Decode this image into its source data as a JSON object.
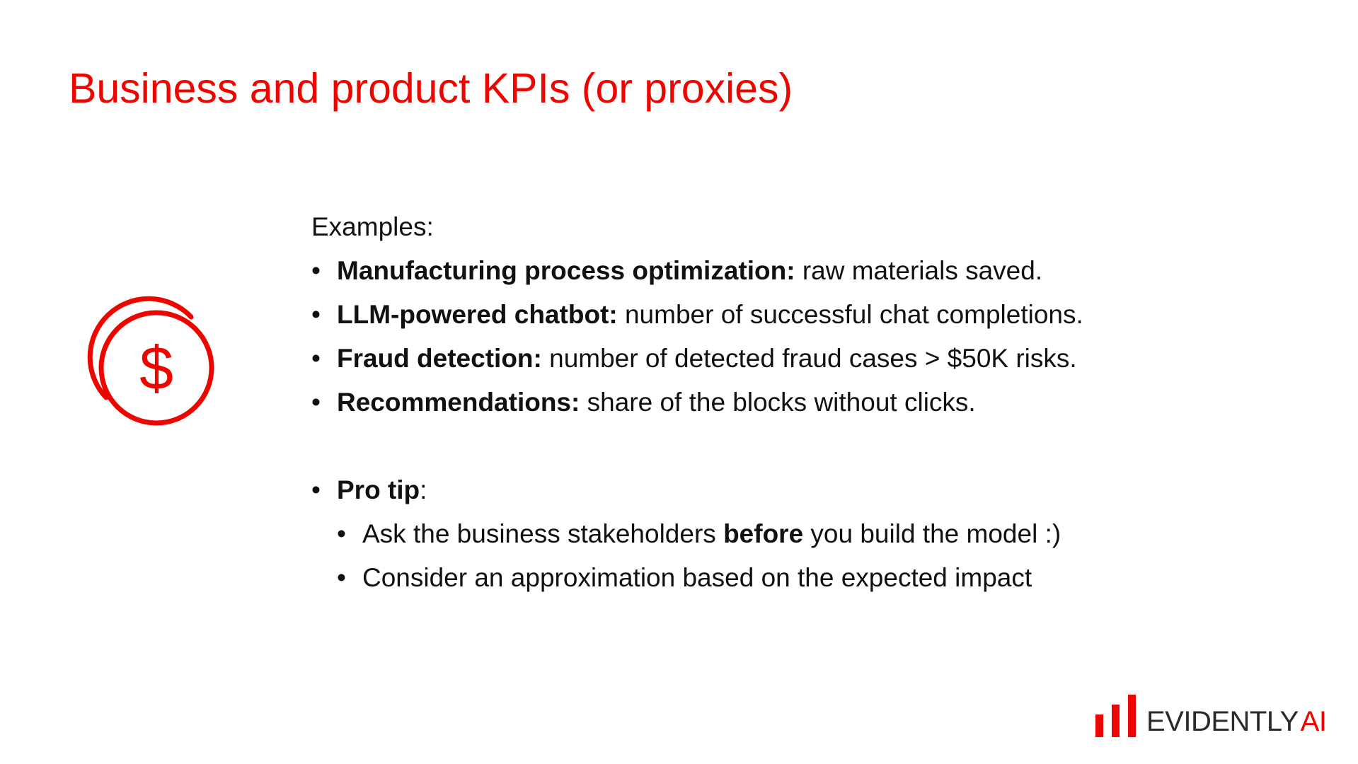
{
  "slide": {
    "title": "Business and product KPIs (or proxies)",
    "accent_color": "#ed0500",
    "intro": "Examples:",
    "examples": [
      {
        "label": "Manufacturing process optimization:",
        "text": " raw materials saved."
      },
      {
        "label": "LLM-powered chatbot:",
        "text": " number of successful chat completions."
      },
      {
        "label": "Fraud detection:",
        "text": " number of detected fraud cases > $50K risks."
      },
      {
        "label": "Recommendations:",
        "text": " share of the blocks without clicks."
      }
    ],
    "pro_tip": {
      "label": "Pro tip",
      "suffix": ":",
      "items": [
        {
          "before": "Ask the business stakeholders ",
          "bold": "before",
          "after": " you build the model :)"
        },
        {
          "text": "Consider an approximation based on the expected impact"
        }
      ]
    },
    "icon": "dollar-coins-icon"
  },
  "logo": {
    "name": "EVIDENTLY",
    "suffix": "AI"
  }
}
